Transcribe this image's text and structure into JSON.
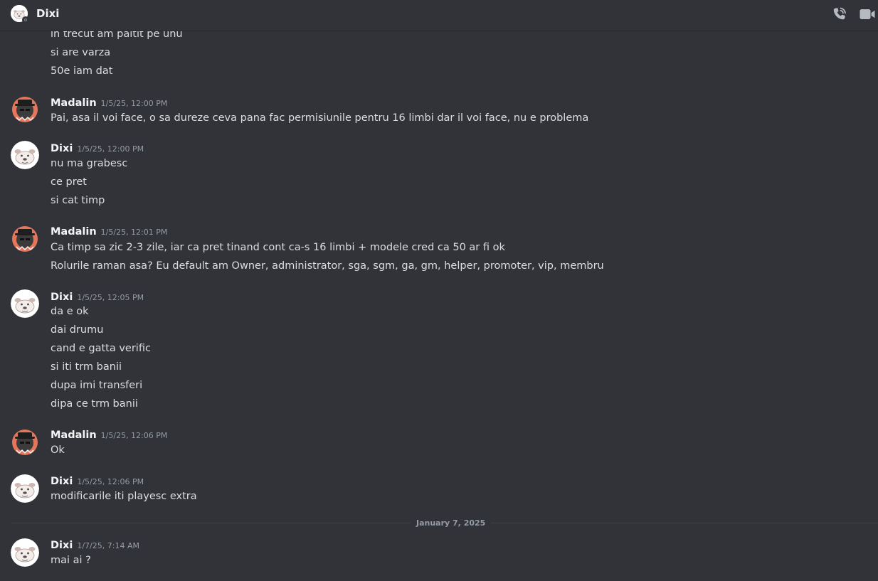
{
  "header": {
    "title": "Dixi",
    "call_icon": "phone-call-icon",
    "video_icon": "video-camera-icon"
  },
  "colors": {
    "background": "#313338",
    "text": "#dbdee1",
    "author": "#f2f3f5",
    "muted": "#949ba4",
    "madalin_avatar_accent": "#e5765c"
  },
  "continuation_lines": [
    "in trecut am paltit pe unu",
    "si are varza",
    "50e iam dat"
  ],
  "messages": [
    {
      "author": "Madalin",
      "timestamp": "1/5/25, 12:00 PM",
      "lines": [
        "Pai, asa il voi face, o sa dureze ceva pana fac permisiunile pentru 16 limbi dar il voi face, nu e problema"
      ]
    },
    {
      "author": "Dixi",
      "timestamp": "1/5/25, 12:00 PM",
      "lines": [
        "nu ma grabesc",
        "ce pret",
        "si cat timp"
      ]
    },
    {
      "author": "Madalin",
      "timestamp": "1/5/25, 12:01 PM",
      "lines": [
        "Ca timp sa zic 2-3 zile, iar ca pret tinand cont ca-s 16 limbi + modele cred ca 50 ar fi ok",
        "Rolurile raman asa? Eu default am Owner, administrator, sga, sgm, ga, gm, helper, promoter, vip, membru"
      ]
    },
    {
      "author": "Dixi",
      "timestamp": "1/5/25, 12:05 PM",
      "lines": [
        "da e ok",
        "dai drumu",
        "cand e gatta verific",
        "si iti trm banii",
        "dupa imi transferi",
        "dipa ce trm banii"
      ]
    },
    {
      "author": "Madalin",
      "timestamp": "1/5/25, 12:06 PM",
      "lines": [
        "Ok"
      ]
    },
    {
      "author": "Dixi",
      "timestamp": "1/5/25, 12:06 PM",
      "lines": [
        "modificarile iti playesc extra"
      ]
    },
    {
      "author": "Dixi",
      "timestamp": "1/7/25, 7:14 AM",
      "lines": [
        "mai ai ?"
      ]
    }
  ],
  "date_divider": "January 7, 2025"
}
